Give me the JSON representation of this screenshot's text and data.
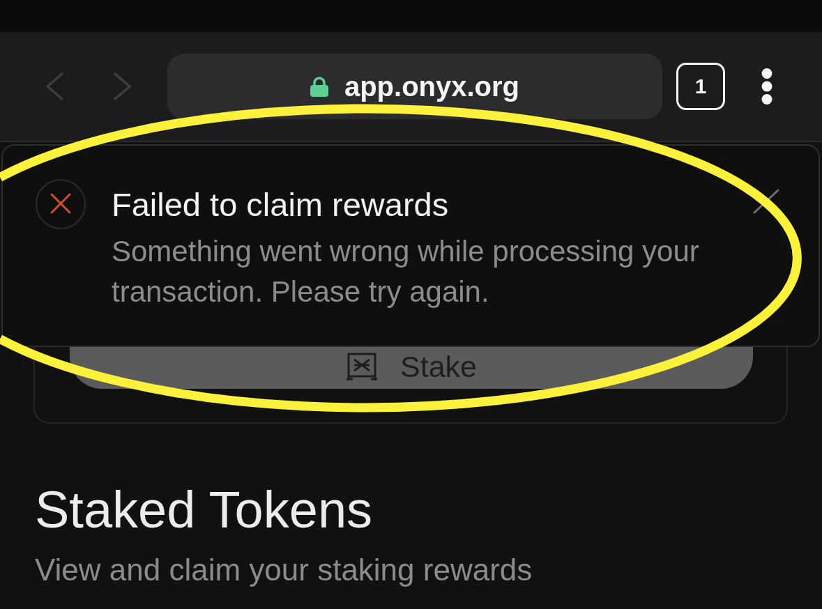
{
  "browser": {
    "back": {
      "disabled": true
    },
    "forward": {
      "disabled": true
    },
    "address_bar": {
      "url": "app.onyx.org",
      "secure": true
    },
    "tab_count": "1"
  },
  "toast": {
    "kind": "error",
    "title": "Failed to claim rewards",
    "message": "Something went wrong while processing your transaction. Please try again."
  },
  "stake_card": {
    "button": "Stake"
  },
  "section": {
    "title": "Staked Tokens",
    "subtitle": "View and claim your staking rewards"
  },
  "annotation": {
    "kind": "ellipse"
  }
}
